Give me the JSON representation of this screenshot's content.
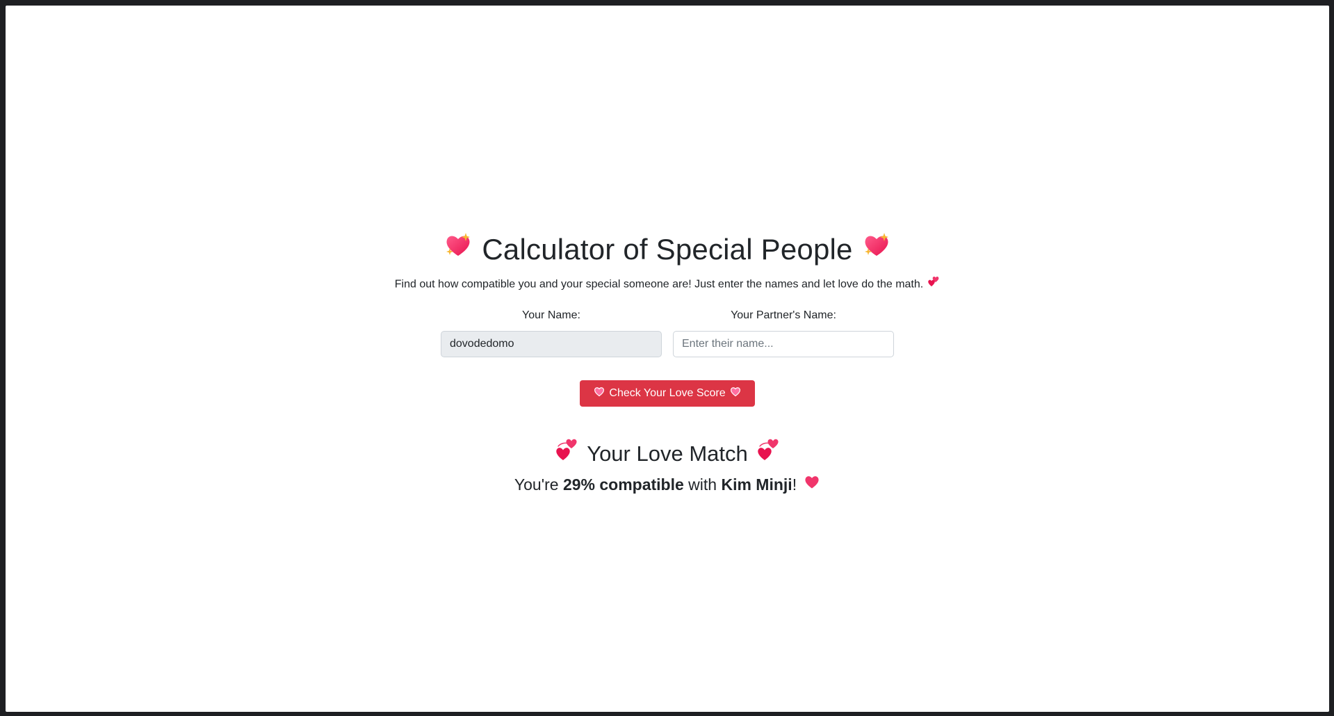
{
  "header": {
    "title": "Calculator of Special People",
    "subtitle": "Find out how compatible you and your special someone are! Just enter the names and let love do the math."
  },
  "form": {
    "your_name_label": "Your Name:",
    "your_name_value": "dovodedomo",
    "partner_name_label": "Your Partner's Name:",
    "partner_name_placeholder": "Enter their name...",
    "partner_name_value": ""
  },
  "button": {
    "label": "Check Your Love Score"
  },
  "result": {
    "title": "Your Love Match",
    "prefix": "You're",
    "percent": "29% compatible",
    "middle": "with",
    "partner": "Kim Minji",
    "suffix": "!"
  },
  "icons": {
    "title_icon": "sparkling-heart-icon",
    "subtitle_icon": "two-hearts-icon",
    "button_icon": "heart-icon",
    "result_title_icon": "revolving-hearts-icon",
    "result_icon": "red-heart-icon"
  },
  "colors": {
    "accent": "#dc3545",
    "heart": "#f0356b",
    "sparkle": "#f7b733"
  }
}
